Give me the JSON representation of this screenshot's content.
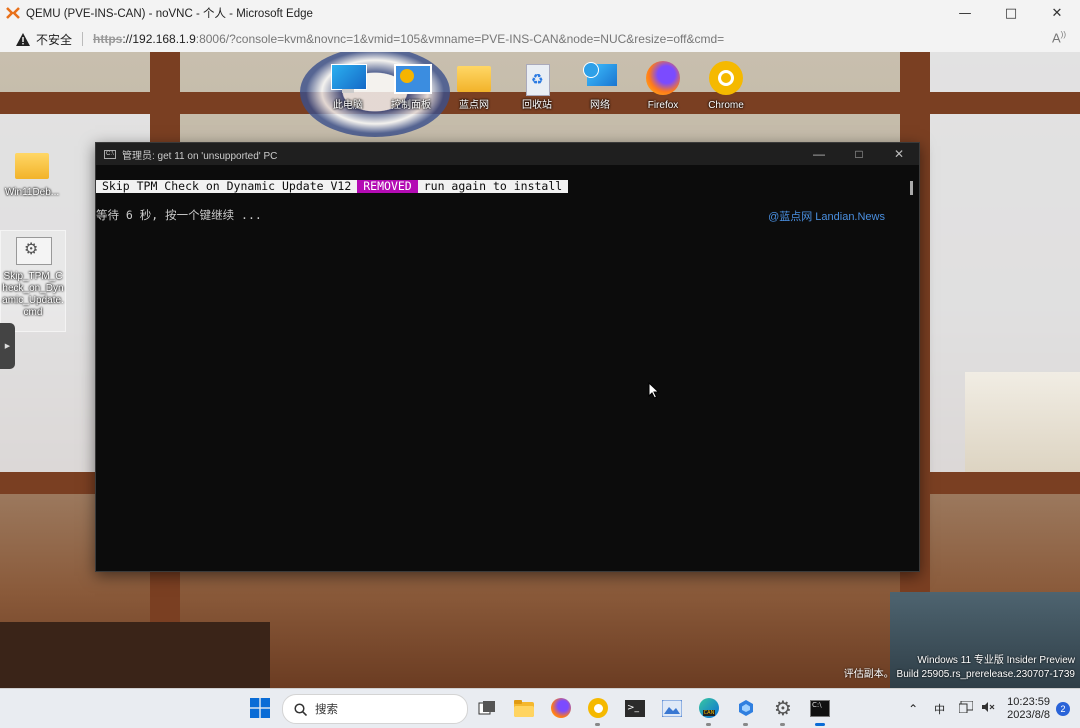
{
  "browser": {
    "title": "QEMU (PVE-INS-CAN) - noVNC - 个人 - Microsoft Edge",
    "insecure_label": "不安全",
    "url_scheme": "https",
    "url_host": "://192.168.1.9",
    "url_rest": ":8006/?console=kvm&novnc=1&vmid=105&vmname=PVE-INS-CAN&node=NUC&resize=off&cmd=",
    "read_aloud": "A⁰"
  },
  "desktop": {
    "icons": [
      {
        "label": "此电脑"
      },
      {
        "label": "控制面板"
      },
      {
        "label": "蓝点网"
      },
      {
        "label": "回收站"
      },
      {
        "label": "网络"
      },
      {
        "label": "Firefox"
      },
      {
        "label": "Chrome"
      }
    ],
    "left_icons": [
      {
        "label": "Win11Deb..."
      },
      {
        "label": "Skip_TPM_Check_on_Dynamic_Update.cmd"
      }
    ]
  },
  "cmd_window": {
    "title": "管理员: get 11 on 'unsupported' PC",
    "banner_part1": "Skip TPM Check on Dynamic Update V12",
    "banner_part2": "REMOVED",
    "banner_part3": "run again to install",
    "wait_text": "等待 6 秒, 按一个键继续 ...",
    "watermark": "@蓝点网 Landian.News"
  },
  "build_info": {
    "line1": "Windows 11 专业版 Insider Preview",
    "line2": "评估副本。 Build 25905.rs_prerelease.230707-1739"
  },
  "taskbar": {
    "search_placeholder": "搜索",
    "ime": "中",
    "time": "10:23:59",
    "date": "2023/8/8",
    "notification_count": "2"
  }
}
